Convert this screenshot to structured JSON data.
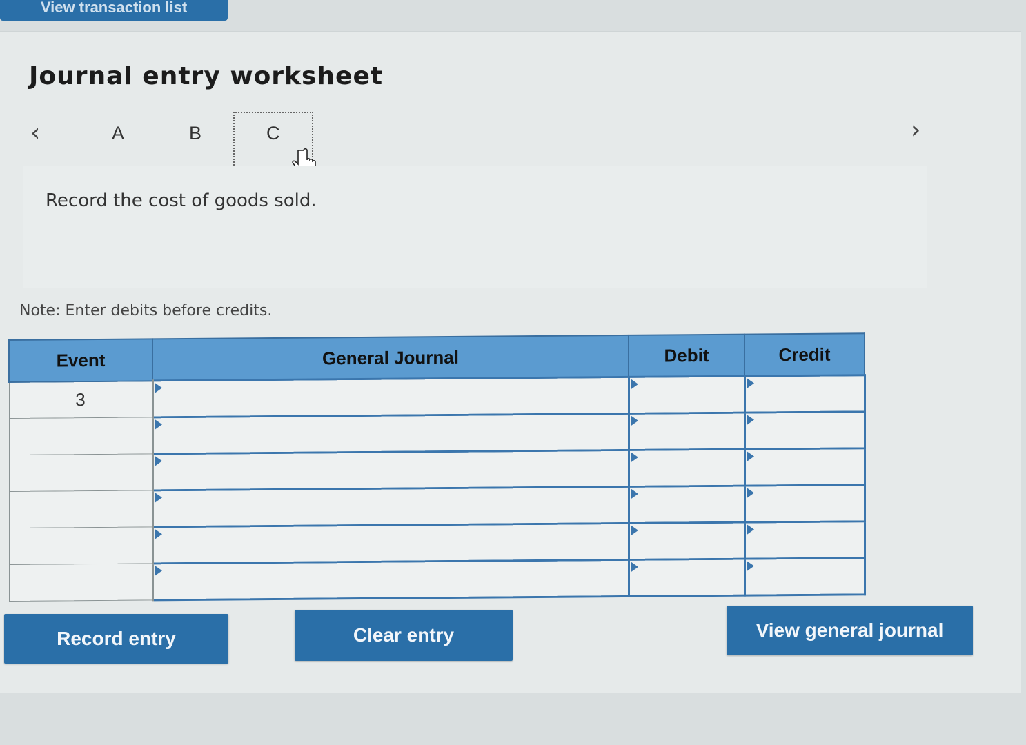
{
  "top_tab": {
    "label": "View transaction list"
  },
  "worksheet": {
    "title": "Journal entry worksheet",
    "nav": {
      "tabs": [
        "A",
        "B",
        "C"
      ],
      "selected": "C"
    },
    "prompt": "Record the cost of goods sold.",
    "note": "Note: Enter debits before credits."
  },
  "journal": {
    "headers": {
      "event": "Event",
      "general_journal": "General Journal",
      "debit": "Debit",
      "credit": "Credit"
    },
    "rows": [
      {
        "event": "3",
        "account": "",
        "debit": "",
        "credit": ""
      },
      {
        "event": "",
        "account": "",
        "debit": "",
        "credit": ""
      },
      {
        "event": "",
        "account": "",
        "debit": "",
        "credit": ""
      },
      {
        "event": "",
        "account": "",
        "debit": "",
        "credit": ""
      },
      {
        "event": "",
        "account": "",
        "debit": "",
        "credit": ""
      },
      {
        "event": "",
        "account": "",
        "debit": "",
        "credit": ""
      }
    ]
  },
  "buttons": {
    "record": "Record entry",
    "clear": "Clear entry",
    "view_journal": "View general journal"
  },
  "colors": {
    "accent": "#2a6fa8",
    "header": "#5b9bd0",
    "grid_line": "#3b76ad"
  }
}
